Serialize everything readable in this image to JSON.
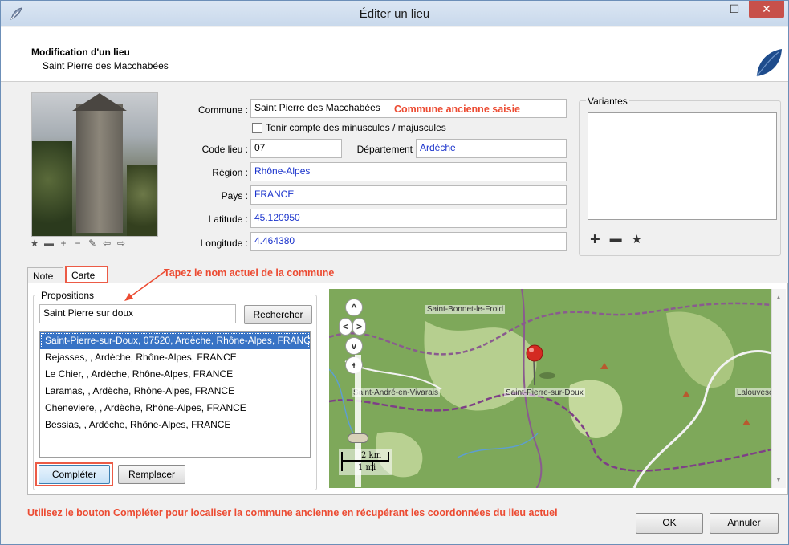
{
  "window": {
    "title": "Éditer un lieu",
    "controls": {
      "minimize": "–",
      "maximize": "☐",
      "close": "✕"
    }
  },
  "header": {
    "heading": "Modification d'un lieu",
    "subheading": "Saint Pierre des Macchabées"
  },
  "photo_tools": [
    "★",
    "▬",
    "+",
    "−",
    "✎",
    "⇦",
    "⇨"
  ],
  "form": {
    "commune_label": "Commune :",
    "commune_value": "Saint Pierre des Macchabées",
    "commune_annotation": "Commune ancienne saisie",
    "case_label": "Tenir compte des minuscules / majuscules",
    "code_label": "Code lieu :",
    "code_value": "07",
    "dept_label": "Département",
    "dept_value": "Ardèche",
    "region_label": "Région :",
    "region_value": "Rhône-Alpes",
    "pays_label": "Pays :",
    "pays_value": "FRANCE",
    "lat_label": "Latitude :",
    "lat_value": "45.120950",
    "lon_label": "Longitude :",
    "lon_value": "4.464380"
  },
  "variantes": {
    "legend": "Variantes",
    "tools": [
      "✚",
      "▬",
      "★"
    ]
  },
  "tabs": {
    "note": "Note",
    "carte": "Carte",
    "annotation": "Tapez le nom actuel de la commune"
  },
  "propositions": {
    "legend": "Propositions",
    "search_value": "Saint Pierre sur doux",
    "search_button": "Rechercher",
    "results": [
      "Saint-Pierre-sur-Doux, 07520, Ardèche, Rhône-Alpes, FRANCE",
      "Rejasses, , Ardèche, Rhône-Alpes, FRANCE",
      "Le Chier, , Ardèche, Rhône-Alpes, FRANCE",
      "Laramas, , Ardèche, Rhône-Alpes, FRANCE",
      "Cheneviere, , Ardèche, Rhône-Alpes, FRANCE",
      "Bessias, , Ardèche, Rhône-Alpes, FRANCE"
    ],
    "completer_button": "Compléter",
    "remplacer_button": "Remplacer"
  },
  "map": {
    "towns": [
      "Saint-Bonnet-le-Froid",
      "Saint-André-en-Vivarais",
      "Saint-Pierre-sur-Doux",
      "Lalouvesc"
    ],
    "scale_top": "2 km",
    "scale_bottom": "1 mi",
    "zoom_in": "+",
    "pan_up": "^",
    "pan_left": "<",
    "pan_right": ">",
    "pan_down": "v"
  },
  "footer": {
    "annotation": "Utilisez le bouton Compléter pour localiser la commune ancienne en récupérant les coordonnées du lieu actuel",
    "ok_button": "OK",
    "cancel_button": "Annuler"
  },
  "colors": {
    "annotation": "#ec4b32",
    "value_text": "#1a33cc",
    "selection": "#3873c5",
    "close_button": "#c7504a",
    "map_green": "#79a155"
  }
}
